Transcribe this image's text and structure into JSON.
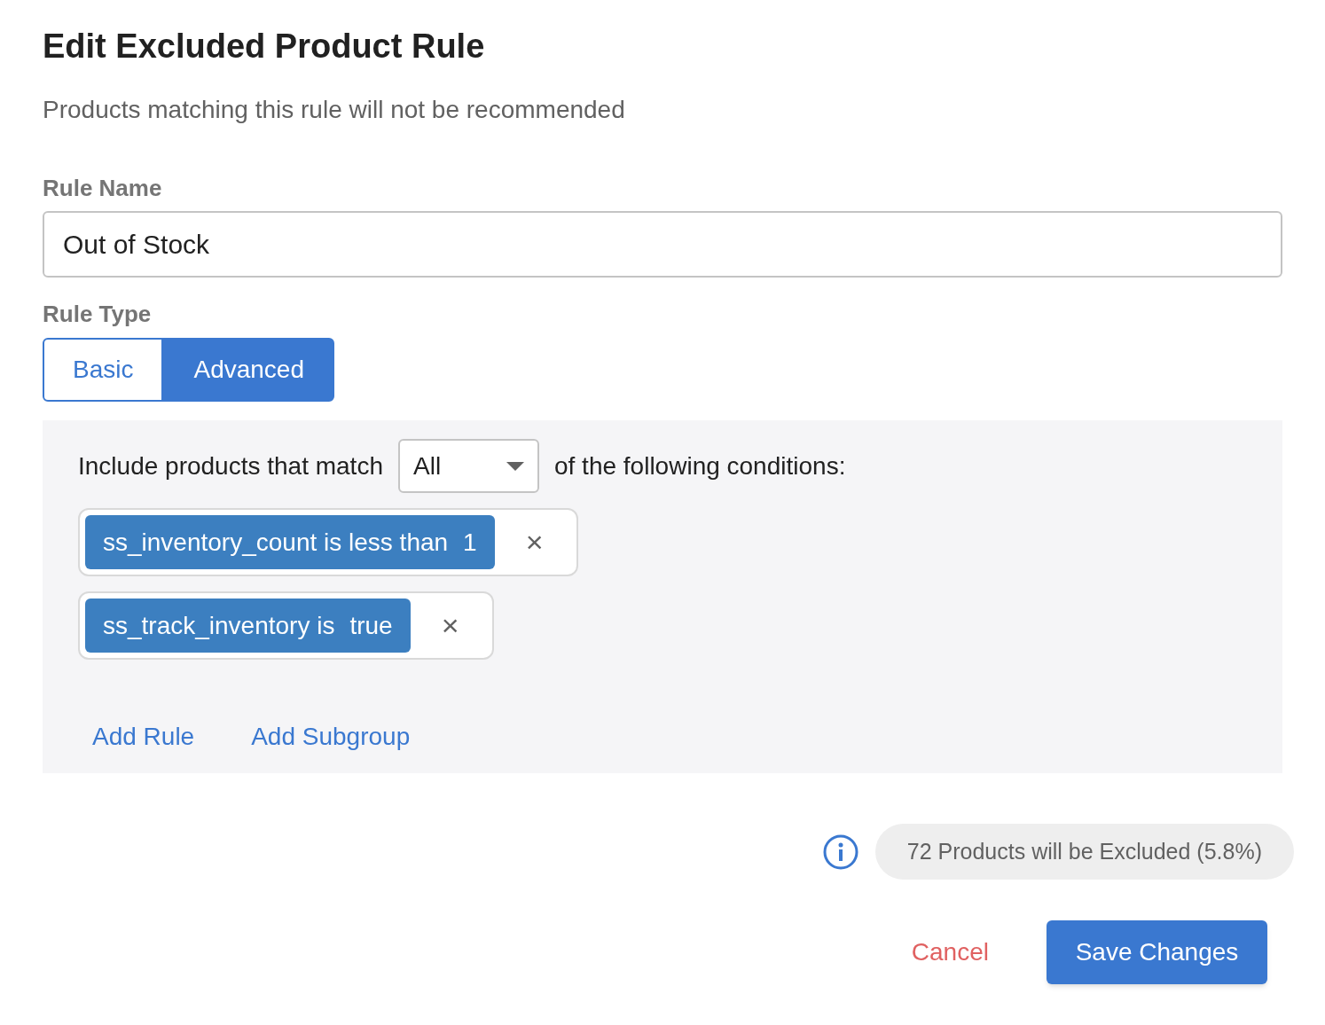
{
  "dialog": {
    "title": "Edit Excluded Product Rule",
    "subtitle": "Products matching this rule will not be recommended"
  },
  "rule_name": {
    "label": "Rule Name",
    "value": "Out of Stock"
  },
  "rule_type": {
    "label": "Rule Type",
    "options": [
      {
        "label": "Basic",
        "selected": false
      },
      {
        "label": "Advanced",
        "selected": true
      }
    ]
  },
  "conditions": {
    "prefix": "Include products that match",
    "match": "All",
    "suffix": "of the following conditions:",
    "rules": [
      {
        "condition": "ss_inventory_count is less than",
        "value": "1",
        "remove": "×"
      },
      {
        "condition": "ss_track_inventory is",
        "value": "true",
        "remove": "×"
      }
    ],
    "actions": [
      "Add Rule",
      "Add Subgroup"
    ]
  },
  "summary": "72 Products will be Excluded (5.8%)",
  "buttons": {
    "cancel": "Cancel",
    "save": "Save Changes"
  }
}
